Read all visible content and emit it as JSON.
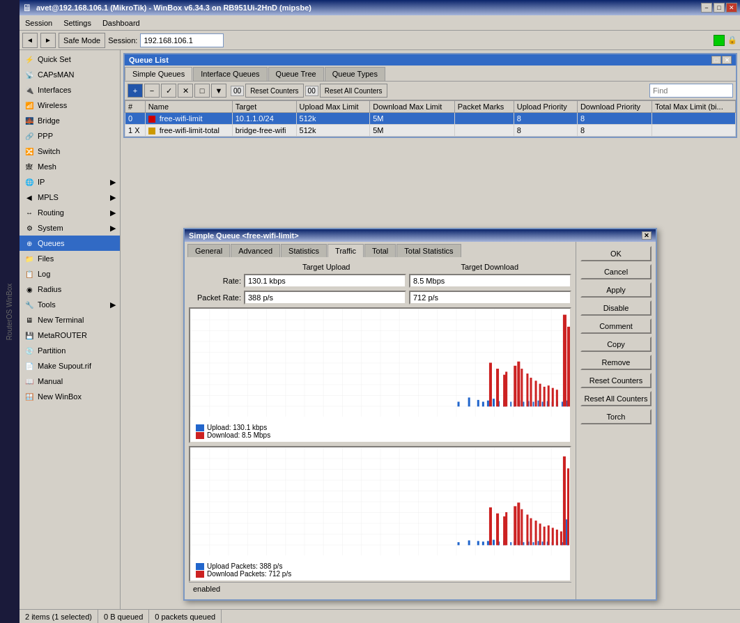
{
  "titlebar": {
    "text": "avet@192.168.106.1 (MikroTik) - WinBox v6.34.3 on RB951Ui-2HnD (mipsbe)",
    "min": "−",
    "max": "□",
    "close": "✕"
  },
  "menubar": {
    "items": [
      "Session",
      "Settings",
      "Dashboard"
    ]
  },
  "toolbar": {
    "back": "◄",
    "forward": "►",
    "safe_mode": "Safe Mode",
    "session_label": "Session:",
    "session_value": "192.168.106.1",
    "indicator_green": "",
    "indicator_lock": "🔒"
  },
  "sidebar": {
    "items": [
      {
        "id": "quick-set",
        "label": "Quick Set",
        "icon": "⚙"
      },
      {
        "id": "capsman",
        "label": "CAPsMAN",
        "icon": "📡"
      },
      {
        "id": "interfaces",
        "label": "Interfaces",
        "icon": "🔌"
      },
      {
        "id": "wireless",
        "label": "Wireless",
        "icon": "📶"
      },
      {
        "id": "bridge",
        "label": "Bridge",
        "icon": "🌉"
      },
      {
        "id": "ppp",
        "label": "PPP",
        "icon": "🔗"
      },
      {
        "id": "switch",
        "label": "Switch",
        "icon": "🔀"
      },
      {
        "id": "mesh",
        "label": "Mesh",
        "icon": "🕸"
      },
      {
        "id": "ip",
        "label": "IP",
        "icon": "🌐",
        "expandable": true
      },
      {
        "id": "mpls",
        "label": "MPLS",
        "icon": "▶",
        "expandable": true
      },
      {
        "id": "routing",
        "label": "Routing",
        "icon": "↔",
        "expandable": true
      },
      {
        "id": "system",
        "label": "System",
        "icon": "⚙",
        "expandable": true
      },
      {
        "id": "queues",
        "label": "Queues",
        "icon": "⊕",
        "selected": true
      },
      {
        "id": "files",
        "label": "Files",
        "icon": "📁"
      },
      {
        "id": "log",
        "label": "Log",
        "icon": "📋"
      },
      {
        "id": "radius",
        "label": "Radius",
        "icon": "◉"
      },
      {
        "id": "tools",
        "label": "Tools",
        "icon": "🔧",
        "expandable": true
      },
      {
        "id": "new-terminal",
        "label": "New Terminal",
        "icon": "🖥"
      },
      {
        "id": "metarouter",
        "label": "MetaROUTER",
        "icon": "💾"
      },
      {
        "id": "partition",
        "label": "Partition",
        "icon": "💿"
      },
      {
        "id": "make-supout",
        "label": "Make Supout.rif",
        "icon": "📄"
      },
      {
        "id": "manual",
        "label": "Manual",
        "icon": "📖"
      },
      {
        "id": "new-winbox",
        "label": "New WinBox",
        "icon": "🪟"
      }
    ]
  },
  "queue_list": {
    "title": "Queue List",
    "tabs": [
      "Simple Queues",
      "Interface Queues",
      "Queue Tree",
      "Queue Types"
    ],
    "active_tab": "Simple Queues",
    "toolbar_icons": [
      "+",
      "−",
      "✓",
      "✕",
      "□",
      "▼"
    ],
    "reset_counters": "Reset Counters",
    "reset_all": "Reset All Counters",
    "find_placeholder": "Find",
    "columns": [
      "#",
      "Name",
      "Target",
      "Upload Max Limit",
      "Download Max Limit",
      "Packet Marks",
      "Upload Priority",
      "Download Priority",
      "Total Max Limit (bi..."
    ],
    "rows": [
      {
        "id": "0",
        "disabled": false,
        "name": "free-wifi-limit",
        "target": "10.1.1.0/24",
        "upload_max": "512k",
        "download_max": "5M",
        "packet_marks": "",
        "upload_priority": "8",
        "download_priority": "8",
        "total_max": ""
      },
      {
        "id": "1",
        "disabled": true,
        "marker": "X",
        "name": "free-wifi-limit-total",
        "target": "bridge-free-wifi",
        "upload_max": "512k",
        "download_max": "5M",
        "packet_marks": "",
        "upload_priority": "8",
        "download_priority": "8",
        "total_max": ""
      }
    ]
  },
  "dialog": {
    "title": "Simple Queue <free-wifi-limit>",
    "tabs": [
      "General",
      "Advanced",
      "Statistics",
      "Traffic",
      "Total",
      "Total Statistics"
    ],
    "active_tab": "Traffic",
    "target_upload_label": "Target Upload",
    "target_download_label": "Target Download",
    "rate_label": "Rate:",
    "rate_upload": "130.1 kbps",
    "rate_download": "8.5 Mbps",
    "packet_rate_label": "Packet Rate:",
    "packet_rate_upload": "388 p/s",
    "packet_rate_download": "712 p/s",
    "upload_legend": "Upload:  130.1 kbps",
    "download_legend": "Download:  8.5 Mbps",
    "upload_packets_legend": "Upload Packets:  388 p/s",
    "download_packets_legend": "Download Packets:  712 p/s",
    "status": "enabled",
    "buttons": {
      "ok": "OK",
      "cancel": "Cancel",
      "apply": "Apply",
      "disable": "Disable",
      "comment": "Comment",
      "copy": "Copy",
      "remove": "Remove",
      "reset_counters": "Reset Counters",
      "reset_all_counters": "Reset All Counters",
      "torch": "Torch"
    }
  },
  "statusbar": {
    "items_count": "2 items (1 selected)",
    "queued": "0 B queued",
    "packets_queued": "0 packets queued"
  },
  "winbox": {
    "label": "RouterOS WinBox"
  }
}
